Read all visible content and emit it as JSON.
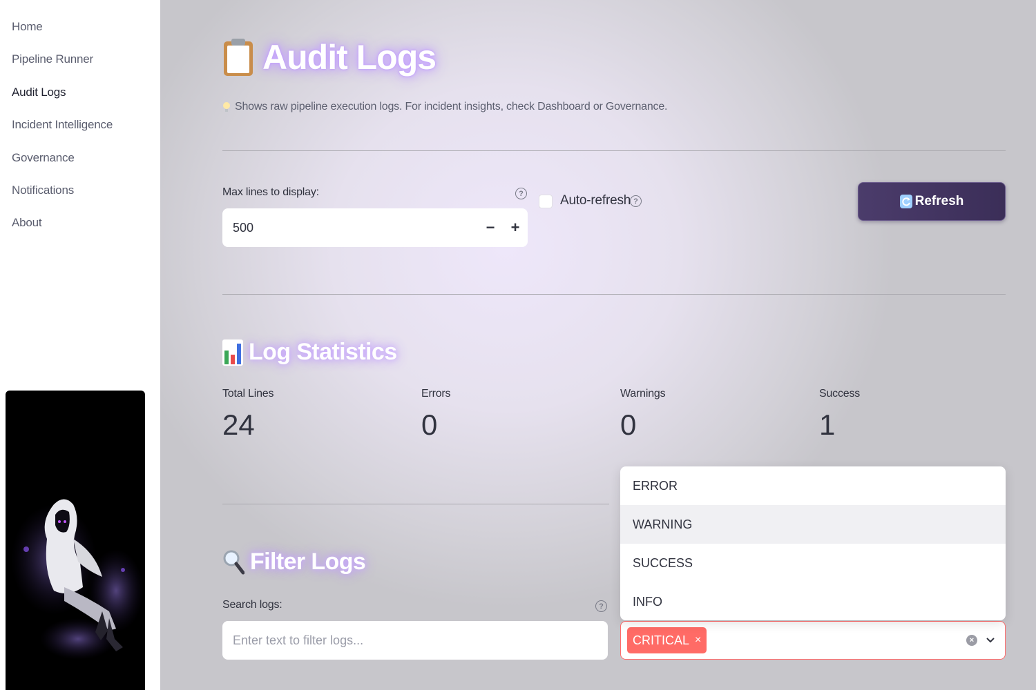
{
  "sidebar": {
    "items": [
      {
        "label": "Home"
      },
      {
        "label": "Pipeline Runner"
      },
      {
        "label": "Audit Logs",
        "active": true
      },
      {
        "label": "Incident Intelligence"
      },
      {
        "label": "Governance"
      },
      {
        "label": "Notifications"
      },
      {
        "label": "About"
      }
    ]
  },
  "page": {
    "title_icon": "clipboard-icon",
    "title": "Audit Logs",
    "subtitle_icon": "lightbulb-icon",
    "subtitle": "Shows raw pipeline execution logs. For incident insights, check Dashboard or Governance."
  },
  "controls": {
    "max_lines_label": "Max lines to display:",
    "max_lines_value": "500",
    "decrement": "−",
    "increment": "+",
    "auto_refresh_label": "Auto-refresh",
    "auto_refresh_checked": false,
    "refresh_label": "Refresh",
    "refresh_icon": "refresh-icon"
  },
  "stats": {
    "title_icon": "bar-chart-icon",
    "title": "Log Statistics",
    "metrics": [
      {
        "label": "Total Lines",
        "value": "24"
      },
      {
        "label": "Errors",
        "value": "0"
      },
      {
        "label": "Warnings",
        "value": "0"
      },
      {
        "label": "Success",
        "value": "1"
      }
    ]
  },
  "filter": {
    "title_icon": "magnifier-icon",
    "title": "Filter Logs",
    "search_label": "Search logs:",
    "search_placeholder": "Enter text to filter logs...",
    "selected_levels": [
      "CRITICAL"
    ],
    "tag_remove": "×",
    "options": [
      "ERROR",
      "WARNING",
      "SUCCESS",
      "INFO"
    ],
    "hovered_option": "WARNING"
  },
  "colors": {
    "accent_button": "#3b2e58",
    "tag": "#ff6b66",
    "glow": "#b68cff"
  }
}
